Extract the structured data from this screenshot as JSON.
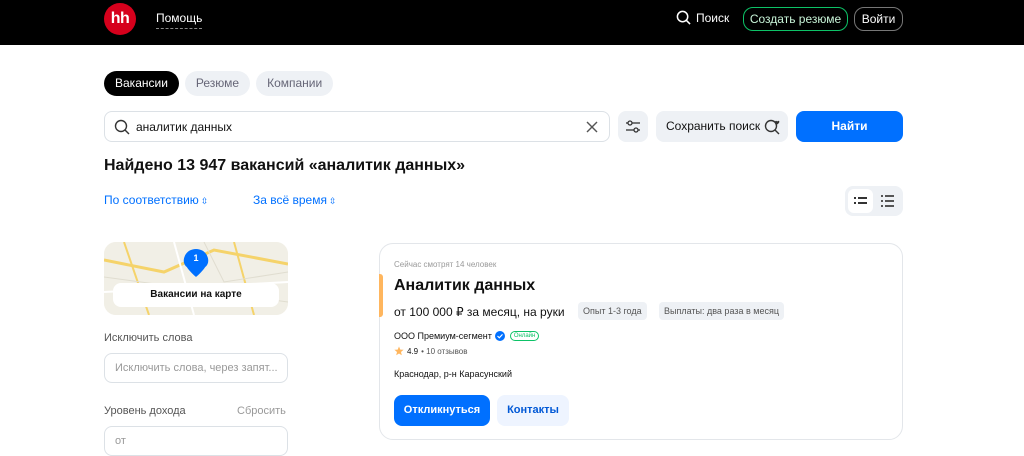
{
  "header": {
    "logo_text": "hh",
    "help_label": "Помощь",
    "search_label": "Поиск",
    "create_resume_label": "Создать резюме",
    "login_label": "Войти"
  },
  "tabs": [
    {
      "label": "Вакансии",
      "active": true
    },
    {
      "label": "Резюме",
      "active": false
    },
    {
      "label": "Компании",
      "active": false
    }
  ],
  "search": {
    "value": "аналитик данных",
    "save_label": "Сохранить поиск",
    "find_label": "Найти"
  },
  "results": {
    "title": "Найдено 13 947 вакансий «аналитик данных»",
    "sort_relevance": "По соответствию",
    "sort_time": "За всё время"
  },
  "sidebar": {
    "map_label": "Вакансии на карте",
    "map_count": "1",
    "exclude_words_label": "Исключить слова",
    "exclude_words_placeholder": "Исключить слова, через запят...",
    "income_label": "Уровень дохода",
    "income_reset": "Сбросить",
    "income_from_placeholder": "от"
  },
  "vacancy": {
    "watching": "Сейчас смотрят 14 человек",
    "title": "Аналитик данных",
    "salary": "от 100 000 ₽ за месяц, на руки",
    "experience": "Опыт 1-3 года",
    "payouts": "Выплаты: два раза в месяц",
    "company": "ООО Премиум-сегмент",
    "online_badge": "Онлайн",
    "rating": "4.9",
    "reviews": "• 10 отзывов",
    "location": "Краснодар, р-н Карасунский",
    "apply_label": "Откликнуться",
    "contacts_label": "Контакты"
  },
  "colors": {
    "brand_red": "#d6001c",
    "primary_blue": "#0070ff",
    "success_green": "#0dc267",
    "accent_orange": "#ffb65e"
  }
}
